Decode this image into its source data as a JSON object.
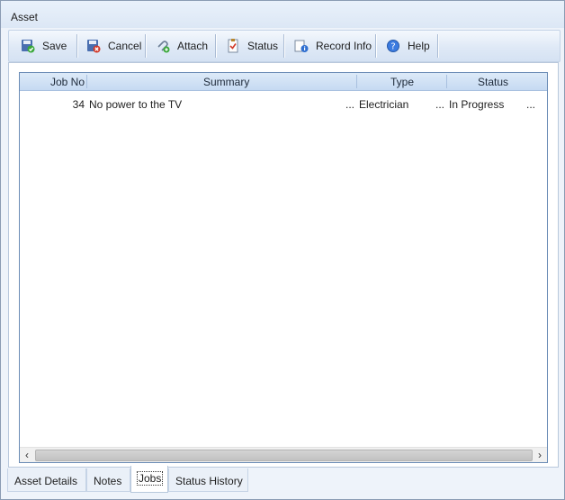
{
  "window": {
    "title": "Asset"
  },
  "toolbar": {
    "save_label": "Save",
    "cancel_label": "Cancel",
    "attach_label": "Attach",
    "status_label": "Status",
    "record_info_label": "Record Info",
    "help_label": "Help"
  },
  "grid": {
    "columns": [
      "Job No",
      "Summary",
      "Type",
      "Status"
    ],
    "rows": [
      {
        "job_no": "34",
        "summary": "No power to the TV",
        "type": "Electrician",
        "status": "In Progress"
      }
    ],
    "ellipsis": "..."
  },
  "tabs": [
    "Asset Details",
    "Notes",
    "Jobs",
    "Status History"
  ],
  "active_tab": "Jobs"
}
